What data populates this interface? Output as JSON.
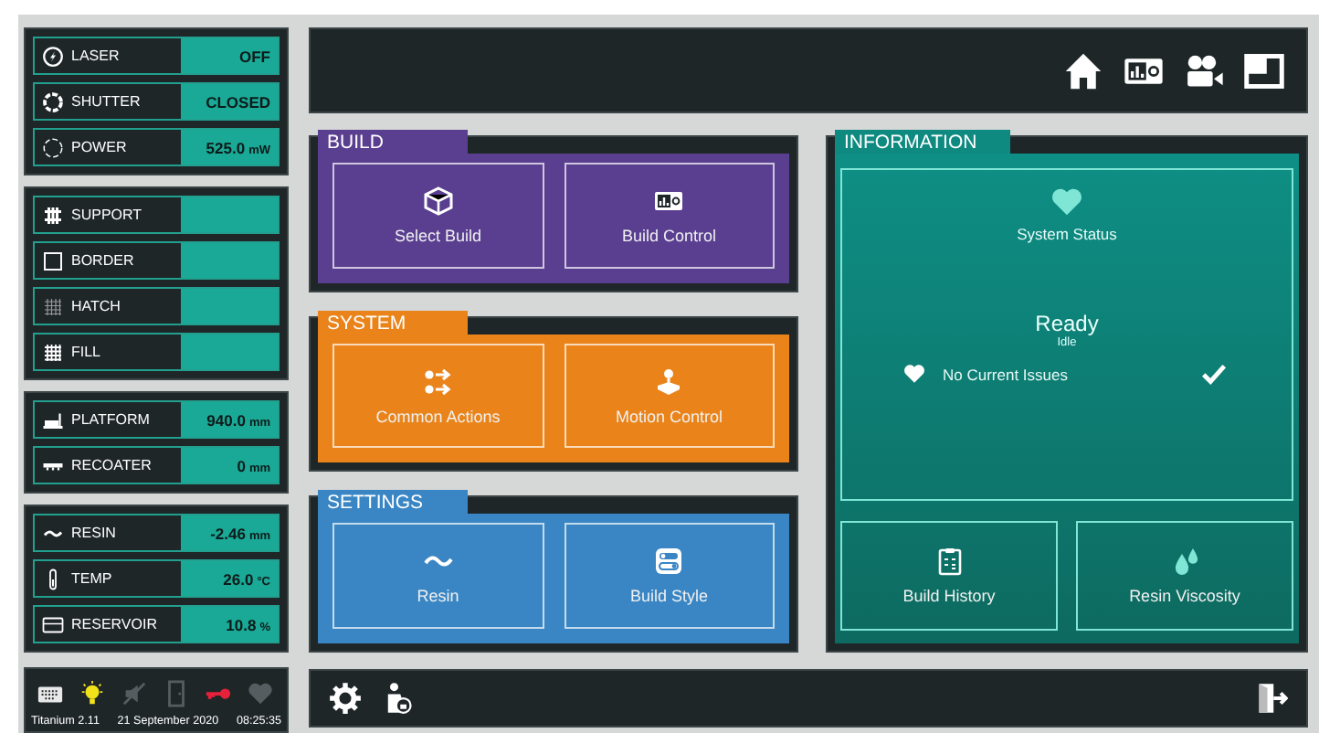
{
  "sidebar": {
    "groups": [
      {
        "rows": [
          {
            "kind": "laser",
            "label": "LASER",
            "value": "OFF"
          },
          {
            "kind": "shutter",
            "label": "SHUTTER",
            "value": "CLOSED"
          },
          {
            "kind": "power",
            "label": "POWER",
            "value": "525.0",
            "unit": "mW"
          }
        ]
      },
      {
        "rows": [
          {
            "kind": "support",
            "label": "SUPPORT"
          },
          {
            "kind": "border",
            "label": "BORDER"
          },
          {
            "kind": "hatch",
            "label": "HATCH"
          },
          {
            "kind": "fill",
            "label": "FILL"
          }
        ]
      },
      {
        "rows": [
          {
            "kind": "platform",
            "label": "PLATFORM",
            "value": "940.0",
            "unit": "mm"
          },
          {
            "kind": "recoater",
            "label": "RECOATER",
            "value": "0",
            "unit": "mm"
          }
        ]
      },
      {
        "rows": [
          {
            "kind": "resin",
            "label": "RESIN",
            "value": "-2.46",
            "unit": "mm"
          },
          {
            "kind": "temp",
            "label": "TEMP",
            "value": "26.0",
            "unit": "°C"
          },
          {
            "kind": "reservoir",
            "label": "RESERVOIR",
            "value": "10.8",
            "unit": "%"
          }
        ]
      }
    ],
    "status_icons": [
      {
        "kind": "keyboard",
        "on": true
      },
      {
        "kind": "bulb",
        "on": true
      },
      {
        "kind": "mute",
        "on": false
      },
      {
        "kind": "door",
        "on": false
      },
      {
        "kind": "key",
        "on": true
      },
      {
        "kind": "heart",
        "on": false
      }
    ],
    "footer": {
      "version": "Titanium 2.11",
      "date": "21 September 2020",
      "time": "08:25:35"
    }
  },
  "top_bar": {
    "icons": [
      {
        "kind": "home"
      },
      {
        "kind": "build-control"
      },
      {
        "kind": "camera"
      },
      {
        "kind": "window"
      }
    ]
  },
  "sections": [
    {
      "title": "BUILD",
      "color": "#5a3f90",
      "tiles": [
        {
          "kind": "cube",
          "label": "Select Build"
        },
        {
          "kind": "build-control",
          "label": "Build Control"
        }
      ]
    },
    {
      "title": "SYSTEM",
      "color": "#ea841a",
      "tiles": [
        {
          "kind": "actions",
          "label": "Common Actions"
        },
        {
          "kind": "joystick",
          "label": "Motion Control"
        }
      ]
    },
    {
      "title": "SETTINGS",
      "color": "#3a86c4",
      "tiles": [
        {
          "kind": "wave",
          "label": "Resin"
        },
        {
          "kind": "toggles",
          "label": "Build Style"
        }
      ]
    }
  ],
  "information": {
    "title": "INFORMATION",
    "status_title": "System Status",
    "status": "Ready",
    "substatus": "Idle",
    "issues": "No Current Issues",
    "tiles": [
      {
        "kind": "clipboard",
        "label": "Build History"
      },
      {
        "kind": "drops",
        "label": "Resin Viscosity"
      }
    ]
  },
  "bottom_bar": {
    "icons": [
      {
        "kind": "gear"
      },
      {
        "kind": "user-lock"
      }
    ],
    "exit": {
      "kind": "exit"
    }
  }
}
